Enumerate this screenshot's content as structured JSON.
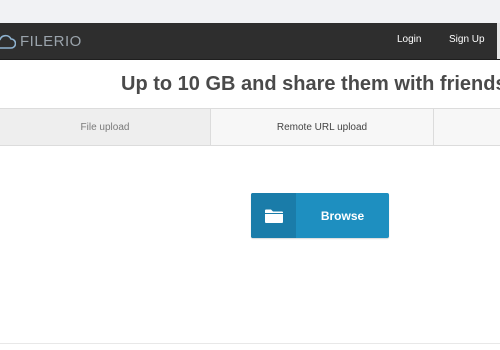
{
  "header": {
    "logo_text": "FILERIO",
    "login": "Login",
    "signup": "Sign Up"
  },
  "main": {
    "headline": "Up to 10 GB and share them with friends",
    "tabs": [
      {
        "label": "File upload"
      },
      {
        "label": "Remote URL upload"
      },
      {
        "label": ""
      }
    ],
    "browse_label": "Browse"
  },
  "icons": {
    "logo": "cloud-icon",
    "browse": "folder-icon"
  },
  "colors": {
    "navbar": "#2e2e2e",
    "browse_button": "#1e8fc0",
    "browse_icon_box": "#1a7ca9"
  }
}
